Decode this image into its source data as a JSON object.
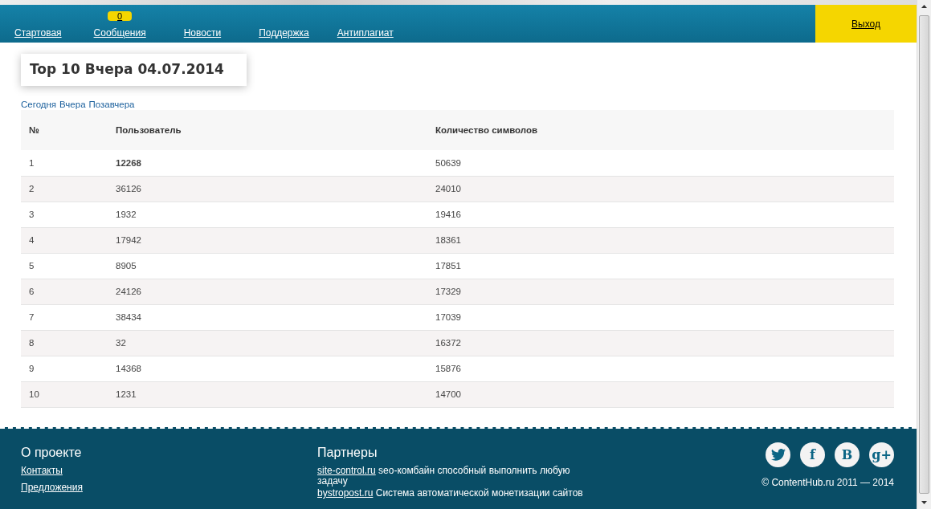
{
  "nav": {
    "items": [
      {
        "label": "Стартовая"
      },
      {
        "label": "Сообщения",
        "badge": "0"
      },
      {
        "label": "Новости"
      },
      {
        "label": "Поддержка"
      },
      {
        "label": "Антиплагиат"
      }
    ],
    "logout": "Выход"
  },
  "title": "Top 10 Вчера 04.07.2014",
  "day_links": [
    {
      "label": "Сегодня"
    },
    {
      "label": "Вчера"
    },
    {
      "label": "Позавчера"
    }
  ],
  "table": {
    "columns": [
      "№",
      "Пользователь",
      "Количество символов"
    ],
    "rows": [
      {
        "cells": [
          "1",
          "12268",
          "50639"
        ],
        "highlighted": true
      },
      {
        "cells": [
          "2",
          "36126",
          "24010"
        ],
        "highlighted": false
      },
      {
        "cells": [
          "3",
          "1932",
          "19416"
        ],
        "highlighted": false
      },
      {
        "cells": [
          "4",
          "17942",
          "18361"
        ],
        "highlighted": false
      },
      {
        "cells": [
          "5",
          "8905",
          "17851"
        ],
        "highlighted": false
      },
      {
        "cells": [
          "6",
          "24126",
          "17329"
        ],
        "highlighted": false
      },
      {
        "cells": [
          "7",
          "38434",
          "17039"
        ],
        "highlighted": false
      },
      {
        "cells": [
          "8",
          "32",
          "16372"
        ],
        "highlighted": false
      },
      {
        "cells": [
          "9",
          "14368",
          "15876"
        ],
        "highlighted": false
      },
      {
        "cells": [
          "10",
          "1231",
          "14700"
        ],
        "highlighted": false
      }
    ]
  },
  "footer": {
    "about": {
      "title": "О проекте",
      "links": [
        "Контакты",
        "Предложения"
      ]
    },
    "partners": {
      "title": "Партнеры",
      "items": [
        {
          "link": "site-control.ru",
          "text": "seo-комбайн способный выполнить любую задачу"
        },
        {
          "link": "bystropost.ru",
          "text": "Система автоматической монетизации сайтов"
        }
      ]
    },
    "social": [
      {
        "kind": "twitter"
      },
      {
        "kind": "glyph",
        "glyph": "f"
      },
      {
        "kind": "glyph",
        "glyph": "B"
      },
      {
        "kind": "glyph",
        "glyph": "g+"
      }
    ],
    "copyright": "© ContentHub.ru 2011 — 2014"
  }
}
